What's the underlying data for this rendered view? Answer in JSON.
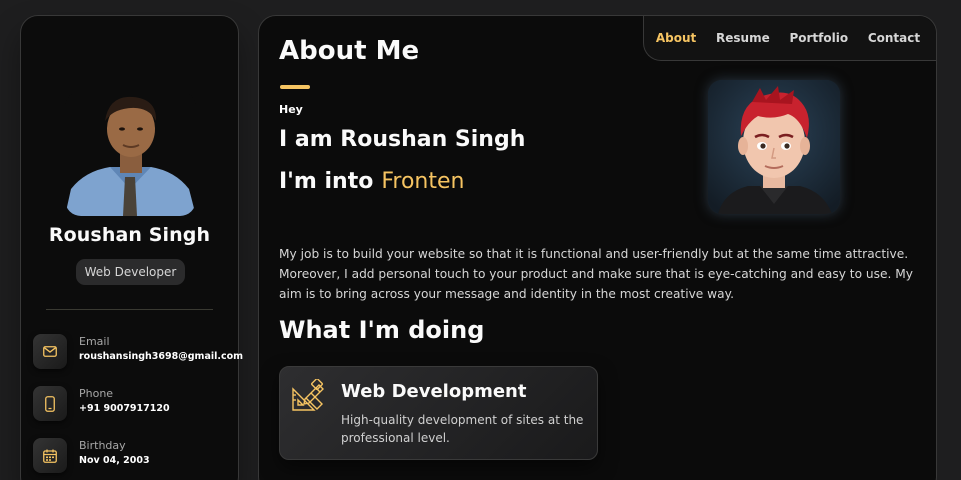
{
  "sidebar": {
    "name": "Roushan Singh",
    "title": "Web Developer",
    "contacts": [
      {
        "label": "Email",
        "value": "roushansingh3698@gmail.com",
        "icon": "mail-icon"
      },
      {
        "label": "Phone",
        "value": "+91 9007917120",
        "icon": "phone-icon"
      },
      {
        "label": "Birthday",
        "value": "Nov 04, 2003",
        "icon": "calendar-icon"
      }
    ]
  },
  "nav": {
    "items": [
      "About",
      "Resume",
      "Portfolio",
      "Contact"
    ],
    "active": "About"
  },
  "about": {
    "title": "About Me",
    "greeting": "Hey",
    "intro_name": "I am Roushan Singh",
    "into_prefix": "I'm into",
    "into_typed": "Fronten",
    "bio": "My job is to build your website so that it is functional and user-friendly but at the same time attractive. Moreover, I add personal touch to your product and make sure that is eye-catching and easy to use. My aim is to bring across your message and identity in the most creative way."
  },
  "doing": {
    "title": "What I'm doing",
    "services": [
      {
        "title": "Web Development",
        "description": "High-quality development of sites at the professional level.",
        "icon": "design-tools-icon"
      }
    ]
  },
  "colors": {
    "accent": "#f6c462",
    "background": "#1e1e1f",
    "panel": "#0b0b0b"
  }
}
